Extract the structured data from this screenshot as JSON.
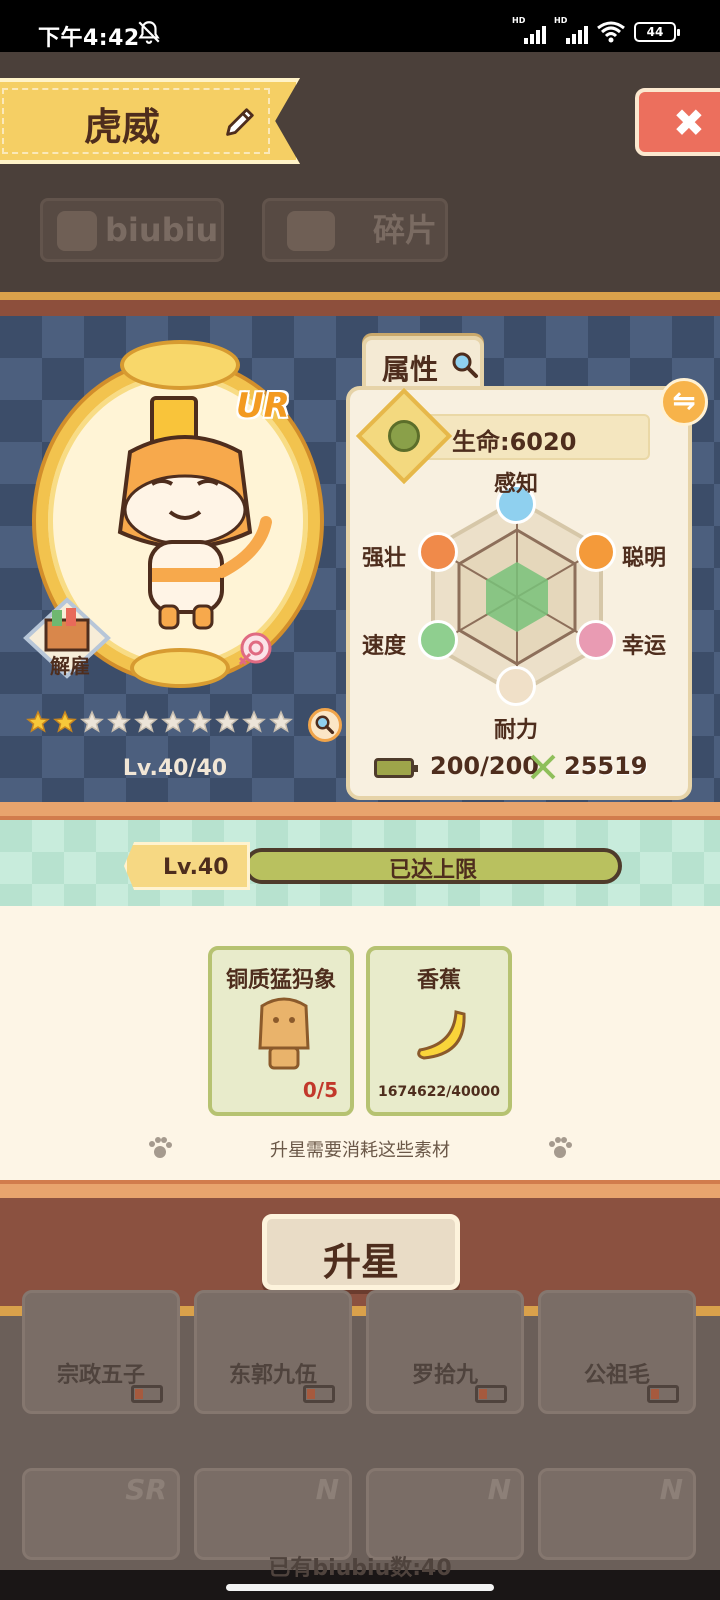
{
  "status_bar": {
    "time": "下午4:42",
    "signal1_label": "HD",
    "signal2_label": "HD",
    "battery": "44"
  },
  "header": {
    "character_name": "虎威"
  },
  "bg_tabs": {
    "biubiu": "biubiu",
    "fragments": "碎片"
  },
  "hero": {
    "rarity": "UR",
    "dismiss_label": "解雇",
    "stars_filled": 2,
    "stars_total": 10,
    "level": "Lv.40/40"
  },
  "attributes": {
    "tab_label": "属性",
    "hp": "生命:6020",
    "stats": {
      "perception": "感知",
      "smart": "聪明",
      "luck": "幸运",
      "stamina": "耐力",
      "speed": "速度",
      "strong": "强壮"
    },
    "energy": "200/200",
    "power": "25519"
  },
  "level_strip": {
    "tag": "Lv.40",
    "status": "已达上限"
  },
  "materials": {
    "items": [
      {
        "name": "铜质猛犸象",
        "count": "0/5"
      },
      {
        "name": "香蕉",
        "count": "1674622/40000"
      }
    ],
    "hint": "升星需要消耗这些素材"
  },
  "action": {
    "upgrade_star": "升星"
  },
  "background_list": {
    "names": [
      "宗政五子",
      "东郭九伍",
      "罗拾九",
      "公祖毛"
    ],
    "rarities": [
      "SR",
      "N",
      "N",
      "N"
    ],
    "count_text": "已有biubiu数:40"
  },
  "colors": {
    "accent_gold": "#f5cf64",
    "panel": "#f8f0e0",
    "brown_text": "#4e2d1d",
    "close_red": "#ec6f5d",
    "mint": "#b7e2cf"
  }
}
